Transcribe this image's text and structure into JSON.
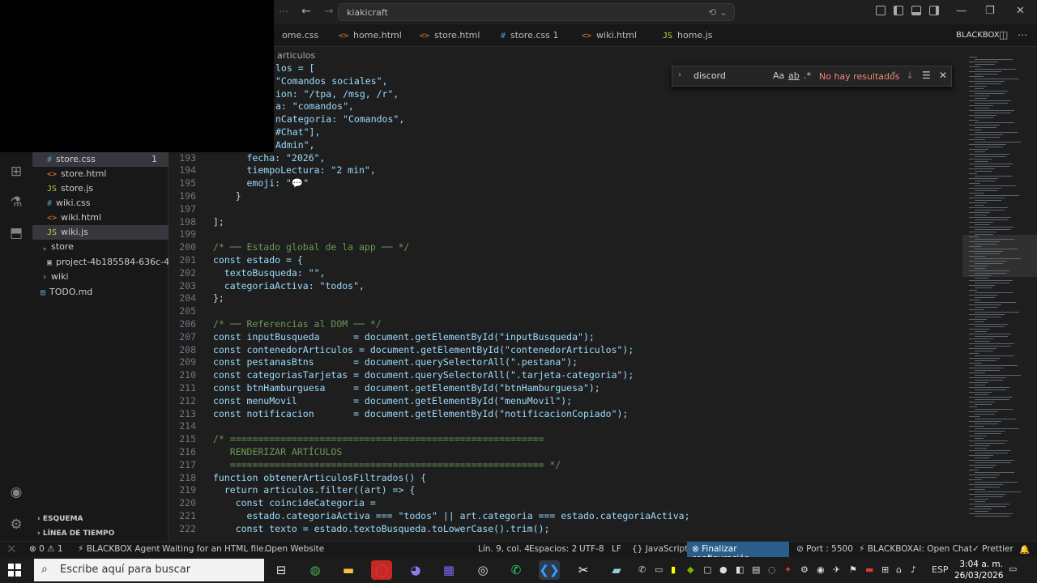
{
  "window": {
    "command_center": "kiakicraft"
  },
  "tabs": [
    {
      "label": "ome.css",
      "type": "css"
    },
    {
      "label": "home.html",
      "type": "html"
    },
    {
      "label": "store.html",
      "type": "html"
    },
    {
      "label": "store.css",
      "badge": "1",
      "type": "css"
    },
    {
      "label": "wiki.html",
      "type": "html"
    },
    {
      "label": "home.js",
      "type": "js"
    }
  ],
  "blackbox_label": "BLACKBOX",
  "breadcrumb": "articulos",
  "explorer": {
    "files": [
      {
        "label": "store.css",
        "icon": "#",
        "badge": "1"
      },
      {
        "label": "store.html",
        "icon": "<>"
      },
      {
        "label": "store.js",
        "icon": "JS"
      },
      {
        "label": "wiki.css",
        "icon": "#"
      },
      {
        "label": "wiki.html",
        "icon": "<>"
      },
      {
        "label": "wiki.js",
        "icon": "JS"
      },
      {
        "label": "store",
        "icon": "v"
      },
      {
        "label": "project-4b185584-636c-4...",
        "icon": "img"
      },
      {
        "label": "wiki",
        "icon": ">"
      },
      {
        "label": "TODO.md",
        "icon": "md"
      }
    ],
    "sections": [
      "ESQUEMA",
      "LÍNEA DE TIEMPO"
    ]
  },
  "find": {
    "value": "discord",
    "options": [
      "Aa",
      "ab",
      ".*"
    ],
    "result": "No hay resultados"
  },
  "code_lines": [
    {
      "n": "",
      "text": "los = ["
    },
    {
      "n": "",
      "text": "\"Comandos sociales\","
    },
    {
      "n": "",
      "text": "ion: \"/tpa, /msg, /r\","
    },
    {
      "n": "",
      "text": "a: \"comandos\","
    },
    {
      "n": "",
      "text": "nCategoria: \"Comandos\","
    },
    {
      "n": "",
      "text": "#Chat\"],"
    },
    {
      "n": "",
      "text": "Admin\","
    },
    {
      "n": "193",
      "text": "      fecha: \"2026\","
    },
    {
      "n": "194",
      "text": "      tiempoLectura: \"2 min\","
    },
    {
      "n": "195",
      "text": "      emoji: \"💬\""
    },
    {
      "n": "196",
      "text": "    }"
    },
    {
      "n": "197",
      "text": ""
    },
    {
      "n": "198",
      "text": "];"
    },
    {
      "n": "199",
      "text": ""
    },
    {
      "n": "200",
      "text": "/* ── Estado global de la app ── */"
    },
    {
      "n": "201",
      "text": "const estado = {"
    },
    {
      "n": "202",
      "text": "  textoBusqueda: \"\","
    },
    {
      "n": "203",
      "text": "  categoriaActiva: \"todos\","
    },
    {
      "n": "204",
      "text": "};"
    },
    {
      "n": "205",
      "text": ""
    },
    {
      "n": "206",
      "text": "/* ── Referencias al DOM ── */"
    },
    {
      "n": "207",
      "text": "const inputBusqueda      = document.getElementById(\"inputBusqueda\");"
    },
    {
      "n": "208",
      "text": "const contenedorArticulos = document.getElementById(\"contenedorArticulos\");"
    },
    {
      "n": "209",
      "text": "const pestanasBtns       = document.querySelectorAll(\".pestana\");"
    },
    {
      "n": "210",
      "text": "const categoriasTarjetas = document.querySelectorAll(\".tarjeta-categoria\");"
    },
    {
      "n": "211",
      "text": "const btnHamburguesa     = document.getElementById(\"btnHamburguesa\");"
    },
    {
      "n": "212",
      "text": "const menuMovil          = document.getElementById(\"menuMovil\");"
    },
    {
      "n": "213",
      "text": "const notificacion       = document.getElementById(\"notificacionCopiado\");"
    },
    {
      "n": "214",
      "text": ""
    },
    {
      "n": "215",
      "text": "/* ========================================================"
    },
    {
      "n": "216",
      "text": "   RENDERIZAR ARTÍCULOS"
    },
    {
      "n": "217",
      "text": "   ======================================================== */"
    },
    {
      "n": "218",
      "text": "function obtenerArticulosFiltrados() {"
    },
    {
      "n": "219",
      "text": "  return articulos.filter((art) => {"
    },
    {
      "n": "220",
      "text": "    const coincideCategoria ="
    },
    {
      "n": "221",
      "text": "      estado.categoriaActiva === \"todos\" || art.categoria === estado.categoriaActiva;"
    },
    {
      "n": "222",
      "text": "    const texto = estado.textoBusqueda.toLowerCase().trim();"
    }
  ],
  "status": {
    "problems": "⊗ 0  ⚠ 1",
    "agent": "BLACKBOX Agent",
    "waiting": "Waiting for an HTML file...",
    "open_website": "Open Website",
    "position": "Lín. 9, col. 4",
    "spaces": "Espacios: 2",
    "encoding": "UTF-8",
    "eol": "LF",
    "language": "JavaScript",
    "finalizar": "Finalizar configuración",
    "port": "Port : 5500",
    "blackboxai": "BLACKBOXAI: Open Chat",
    "prettier": "Prettier"
  },
  "taskbar": {
    "search_placeholder": "Escribe aquí para buscar",
    "lang": "ESP",
    "time": "3:04 a. m.",
    "date": "26/03/2026"
  },
  "colors": {
    "accent": "#0078d4",
    "status_highlight": "#2a5d8a",
    "find_noresult": "#f48771"
  }
}
